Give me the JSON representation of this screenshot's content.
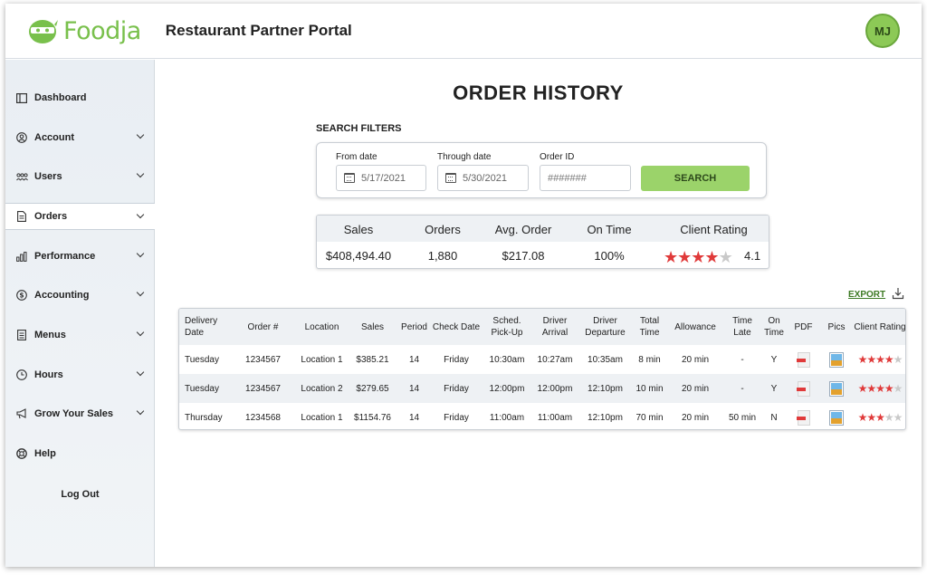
{
  "header": {
    "brand": "Foodja",
    "portal_title": "Restaurant Partner Portal",
    "avatar_initials": "MJ"
  },
  "sidebar": {
    "items": [
      {
        "label": "Dashboard",
        "icon": "layout-icon",
        "has_chevron": false,
        "active": false
      },
      {
        "label": "Account",
        "icon": "user-circle-icon",
        "has_chevron": true,
        "active": false
      },
      {
        "label": "Users",
        "icon": "users-icon",
        "has_chevron": true,
        "active": false
      },
      {
        "label": "Orders",
        "icon": "document-icon",
        "has_chevron": true,
        "active": true
      },
      {
        "label": "Performance",
        "icon": "bar-chart-icon",
        "has_chevron": true,
        "active": false
      },
      {
        "label": "Accounting",
        "icon": "dollar-circle-icon",
        "has_chevron": true,
        "active": false
      },
      {
        "label": "Menus",
        "icon": "menu-icon",
        "has_chevron": true,
        "active": false
      },
      {
        "label": "Hours",
        "icon": "clock-icon",
        "has_chevron": true,
        "active": false
      },
      {
        "label": "Grow Your Sales",
        "icon": "megaphone-icon",
        "has_chevron": true,
        "active": false
      },
      {
        "label": "Help",
        "icon": "lifebuoy-icon",
        "has_chevron": false,
        "active": false
      }
    ],
    "logout_label": "Log Out"
  },
  "main": {
    "title": "ORDER HISTORY",
    "filters": {
      "label": "SEARCH FILTERS",
      "from_label": "From date",
      "from_value": "5/17/2021",
      "through_label": "Through date",
      "through_value": "5/30/2021",
      "order_id_label": "Order ID",
      "order_id_placeholder": "#######",
      "search_label": "SEARCH"
    },
    "summary": {
      "headers": [
        "Sales",
        "Orders",
        "Avg. Order",
        "On Time",
        "Client Rating"
      ],
      "values": [
        "$408,494.40",
        "1,880",
        "$217.08",
        "100%"
      ],
      "rating": 4.1,
      "rating_text": "4.1",
      "stars_filled": 4
    },
    "export_label": "EXPORT",
    "table": {
      "headers": [
        "Delivery Date",
        "Order #",
        "Location",
        "Sales",
        "Period",
        "Check Date",
        "Sched. Pick-Up",
        "Driver Arrival",
        "Driver Departure",
        "Total Time",
        "Allowance",
        "Time Late",
        "On Time",
        "PDF",
        "Pics",
        "Client Rating"
      ],
      "rows": [
        {
          "delivery_date": "Tuesday",
          "order": "1234567",
          "location": "Location 1",
          "sales": "$385.21",
          "period": "14",
          "check_date": "Friday",
          "pickup": "10:30am",
          "arrival": "10:27am",
          "departure": "10:35am",
          "total": "8 min",
          "allowance": "20 min",
          "late": "-",
          "on_time": "Y",
          "rating_stars": 4
        },
        {
          "delivery_date": "Tuesday",
          "order": "1234567",
          "location": "Location 2",
          "sales": "$279.65",
          "period": "14",
          "check_date": "Friday",
          "pickup": "12:00pm",
          "arrival": "12:00pm",
          "departure": "12:10pm",
          "total": "10 min",
          "allowance": "20 min",
          "late": "-",
          "on_time": "Y",
          "rating_stars": 4
        },
        {
          "delivery_date": "Thursday",
          "order": "1234568",
          "location": "Location 1",
          "sales": "$1154.76",
          "period": "14",
          "check_date": "Friday",
          "pickup": "11:00am",
          "arrival": "11:00am",
          "departure": "12:10pm",
          "total": "70 min",
          "allowance": "20 min",
          "late": "50 min",
          "on_time": "N",
          "rating_stars": 3
        }
      ]
    }
  },
  "colors": {
    "brand_green": "#79c04c",
    "button_green": "#9bd36a",
    "star_red": "#e03a3a",
    "star_gray": "#c9c9c9",
    "row_alt": "#eef1f4"
  }
}
